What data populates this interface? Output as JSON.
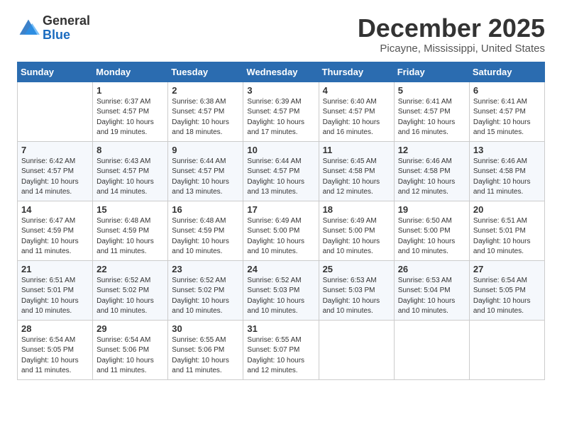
{
  "header": {
    "logo_general": "General",
    "logo_blue": "Blue",
    "month_title": "December 2025",
    "location": "Picayne, Mississippi, United States"
  },
  "weekdays": [
    "Sunday",
    "Monday",
    "Tuesday",
    "Wednesday",
    "Thursday",
    "Friday",
    "Saturday"
  ],
  "weeks": [
    [
      {
        "day": "",
        "info": ""
      },
      {
        "day": "1",
        "info": "Sunrise: 6:37 AM\nSunset: 4:57 PM\nDaylight: 10 hours\nand 19 minutes."
      },
      {
        "day": "2",
        "info": "Sunrise: 6:38 AM\nSunset: 4:57 PM\nDaylight: 10 hours\nand 18 minutes."
      },
      {
        "day": "3",
        "info": "Sunrise: 6:39 AM\nSunset: 4:57 PM\nDaylight: 10 hours\nand 17 minutes."
      },
      {
        "day": "4",
        "info": "Sunrise: 6:40 AM\nSunset: 4:57 PM\nDaylight: 10 hours\nand 16 minutes."
      },
      {
        "day": "5",
        "info": "Sunrise: 6:41 AM\nSunset: 4:57 PM\nDaylight: 10 hours\nand 16 minutes."
      },
      {
        "day": "6",
        "info": "Sunrise: 6:41 AM\nSunset: 4:57 PM\nDaylight: 10 hours\nand 15 minutes."
      }
    ],
    [
      {
        "day": "7",
        "info": "Sunrise: 6:42 AM\nSunset: 4:57 PM\nDaylight: 10 hours\nand 14 minutes."
      },
      {
        "day": "8",
        "info": "Sunrise: 6:43 AM\nSunset: 4:57 PM\nDaylight: 10 hours\nand 14 minutes."
      },
      {
        "day": "9",
        "info": "Sunrise: 6:44 AM\nSunset: 4:57 PM\nDaylight: 10 hours\nand 13 minutes."
      },
      {
        "day": "10",
        "info": "Sunrise: 6:44 AM\nSunset: 4:57 PM\nDaylight: 10 hours\nand 13 minutes."
      },
      {
        "day": "11",
        "info": "Sunrise: 6:45 AM\nSunset: 4:58 PM\nDaylight: 10 hours\nand 12 minutes."
      },
      {
        "day": "12",
        "info": "Sunrise: 6:46 AM\nSunset: 4:58 PM\nDaylight: 10 hours\nand 12 minutes."
      },
      {
        "day": "13",
        "info": "Sunrise: 6:46 AM\nSunset: 4:58 PM\nDaylight: 10 hours\nand 11 minutes."
      }
    ],
    [
      {
        "day": "14",
        "info": "Sunrise: 6:47 AM\nSunset: 4:59 PM\nDaylight: 10 hours\nand 11 minutes."
      },
      {
        "day": "15",
        "info": "Sunrise: 6:48 AM\nSunset: 4:59 PM\nDaylight: 10 hours\nand 11 minutes."
      },
      {
        "day": "16",
        "info": "Sunrise: 6:48 AM\nSunset: 4:59 PM\nDaylight: 10 hours\nand 10 minutes."
      },
      {
        "day": "17",
        "info": "Sunrise: 6:49 AM\nSunset: 5:00 PM\nDaylight: 10 hours\nand 10 minutes."
      },
      {
        "day": "18",
        "info": "Sunrise: 6:49 AM\nSunset: 5:00 PM\nDaylight: 10 hours\nand 10 minutes."
      },
      {
        "day": "19",
        "info": "Sunrise: 6:50 AM\nSunset: 5:00 PM\nDaylight: 10 hours\nand 10 minutes."
      },
      {
        "day": "20",
        "info": "Sunrise: 6:51 AM\nSunset: 5:01 PM\nDaylight: 10 hours\nand 10 minutes."
      }
    ],
    [
      {
        "day": "21",
        "info": "Sunrise: 6:51 AM\nSunset: 5:01 PM\nDaylight: 10 hours\nand 10 minutes."
      },
      {
        "day": "22",
        "info": "Sunrise: 6:52 AM\nSunset: 5:02 PM\nDaylight: 10 hours\nand 10 minutes."
      },
      {
        "day": "23",
        "info": "Sunrise: 6:52 AM\nSunset: 5:02 PM\nDaylight: 10 hours\nand 10 minutes."
      },
      {
        "day": "24",
        "info": "Sunrise: 6:52 AM\nSunset: 5:03 PM\nDaylight: 10 hours\nand 10 minutes."
      },
      {
        "day": "25",
        "info": "Sunrise: 6:53 AM\nSunset: 5:03 PM\nDaylight: 10 hours\nand 10 minutes."
      },
      {
        "day": "26",
        "info": "Sunrise: 6:53 AM\nSunset: 5:04 PM\nDaylight: 10 hours\nand 10 minutes."
      },
      {
        "day": "27",
        "info": "Sunrise: 6:54 AM\nSunset: 5:05 PM\nDaylight: 10 hours\nand 10 minutes."
      }
    ],
    [
      {
        "day": "28",
        "info": "Sunrise: 6:54 AM\nSunset: 5:05 PM\nDaylight: 10 hours\nand 11 minutes."
      },
      {
        "day": "29",
        "info": "Sunrise: 6:54 AM\nSunset: 5:06 PM\nDaylight: 10 hours\nand 11 minutes."
      },
      {
        "day": "30",
        "info": "Sunrise: 6:55 AM\nSunset: 5:06 PM\nDaylight: 10 hours\nand 11 minutes."
      },
      {
        "day": "31",
        "info": "Sunrise: 6:55 AM\nSunset: 5:07 PM\nDaylight: 10 hours\nand 12 minutes."
      },
      {
        "day": "",
        "info": ""
      },
      {
        "day": "",
        "info": ""
      },
      {
        "day": "",
        "info": ""
      }
    ]
  ]
}
